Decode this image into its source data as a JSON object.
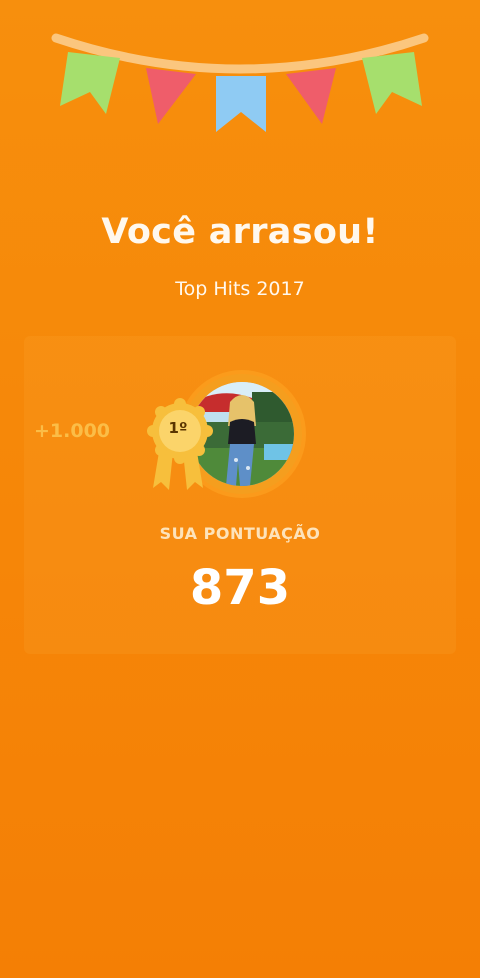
{
  "result": {
    "headline": "Você arrasou!",
    "playlist_name": "Top Hits 2017"
  },
  "score_card": {
    "bonus_points": "+1.000",
    "rank_label": "1º",
    "score_label": "SUA PONTUAÇÃO",
    "score_value": "873"
  },
  "colors": {
    "background": "#f78f0d",
    "flag_green": "#a6df6d",
    "flag_red": "#ef5d6a",
    "flag_blue": "#8fcbf3",
    "bunting_string": "#fbc67e",
    "medal_gold": "#f7bf3c",
    "bonus_text": "#fbbd47"
  },
  "icons": {
    "bunting": "party-bunting-flags",
    "medal": "rank-medal-ribbon",
    "avatar": "user-avatar-photo"
  }
}
